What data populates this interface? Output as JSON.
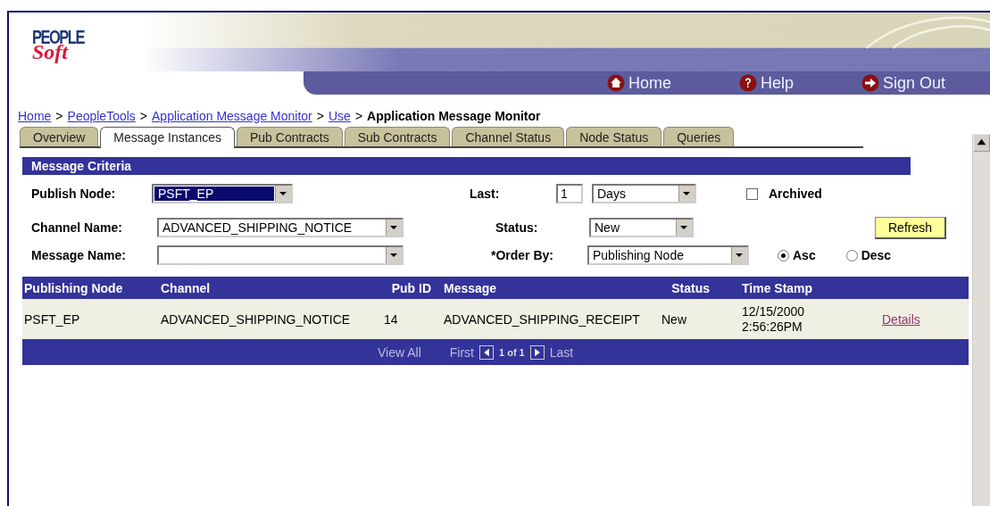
{
  "logo": {
    "top": "PEOPLE",
    "bottom": "Soft"
  },
  "nav": [
    {
      "kind": "home",
      "label": "Home"
    },
    {
      "kind": "help",
      "label": "Help"
    },
    {
      "kind": "signout",
      "label": "Sign Out"
    }
  ],
  "breadcrumb": [
    {
      "label": "Home",
      "link": true
    },
    {
      "label": "PeopleTools",
      "link": true
    },
    {
      "label": "Application Message Monitor",
      "link": true
    },
    {
      "label": "Use",
      "link": true
    },
    {
      "label": "Application Message Monitor",
      "link": false
    }
  ],
  "breadcrumb_separator": ">",
  "tabs": [
    {
      "label": "Overview",
      "selected": false
    },
    {
      "label": "Message Instances",
      "selected": true
    },
    {
      "label": "Pub Contracts",
      "selected": false
    },
    {
      "label": "Sub Contracts",
      "selected": false
    },
    {
      "label": "Channel Status",
      "selected": false
    },
    {
      "label": "Node Status",
      "selected": false
    },
    {
      "label": "Queries",
      "selected": false
    }
  ],
  "criteria": {
    "title": "Message Criteria",
    "publish_node": {
      "label": "Publish Node:",
      "value": "PSFT_EP",
      "highlighted": true
    },
    "last": {
      "label": "Last:",
      "value": "1",
      "unit": "Days"
    },
    "archived": {
      "label": "Archived",
      "checked": false
    },
    "channel_name": {
      "label": "Channel Name:",
      "value": "ADVANCED_SHIPPING_NOTICE"
    },
    "status": {
      "label": "Status:",
      "value": "New"
    },
    "refresh": "Refresh",
    "message_name": {
      "label": "Message Name:"
    },
    "order_by": {
      "label": "*Order By:",
      "value": "Publishing Node"
    },
    "sort": [
      {
        "label": "Asc",
        "selected": true
      },
      {
        "label": "Desc",
        "selected": false
      }
    ]
  },
  "grid": {
    "columns": [
      "Publishing Node",
      "Channel",
      "Pub ID",
      "Message",
      "Status",
      "Time Stamp"
    ],
    "rows": [
      {
        "node": "PSFT_EP",
        "channel": "ADVANCED_SHIPPING_NOTICE",
        "pub_id": "14",
        "message": "ADVANCED_SHIPPING_RECEIPT",
        "status": "New",
        "time_stamp": [
          "12/15/2000",
          "2:56:26PM"
        ],
        "link": "Details"
      }
    ],
    "footer": {
      "view_all": "View All",
      "first": "First",
      "range": "1 of 1",
      "last": "Last"
    }
  }
}
